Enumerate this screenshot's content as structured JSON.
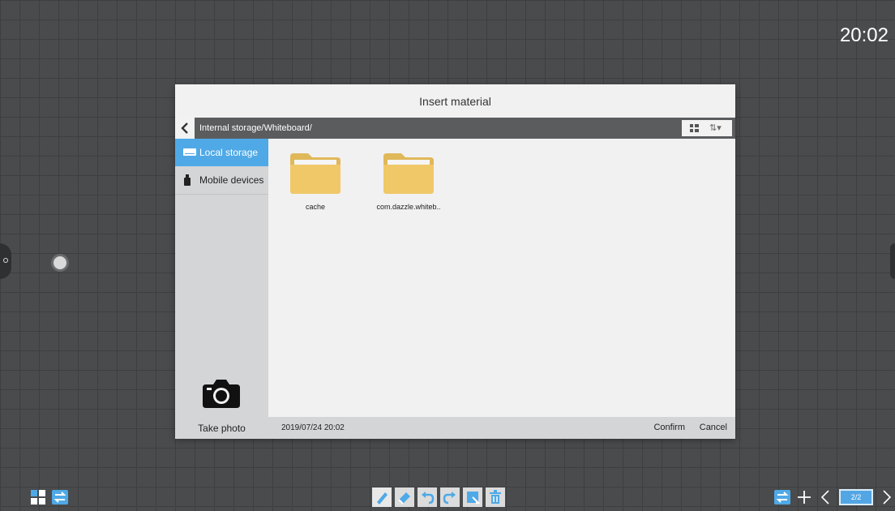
{
  "status": {
    "clock": "20:02"
  },
  "dialog": {
    "title": "Insert material",
    "path": "Internal storage/Whiteboard/",
    "sidebar": [
      {
        "label": "Local storage",
        "icon": "drive-icon",
        "active": true
      },
      {
        "label": "Mobile devices",
        "icon": "usb-icon",
        "active": false
      }
    ],
    "take_photo": "Take photo",
    "folders": [
      {
        "name": "cache"
      },
      {
        "name": "com.dazzle.whiteb.."
      }
    ],
    "footer": {
      "date": "2019/07/24 20:02",
      "confirm": "Confirm",
      "cancel": "Cancel"
    }
  },
  "toolbar": {
    "tools": [
      "pen-icon",
      "eraser-icon",
      "undo-icon",
      "redo-icon",
      "select-icon",
      "delete-icon"
    ],
    "page_indicator": "2/2",
    "accent": "#52a6e4"
  }
}
